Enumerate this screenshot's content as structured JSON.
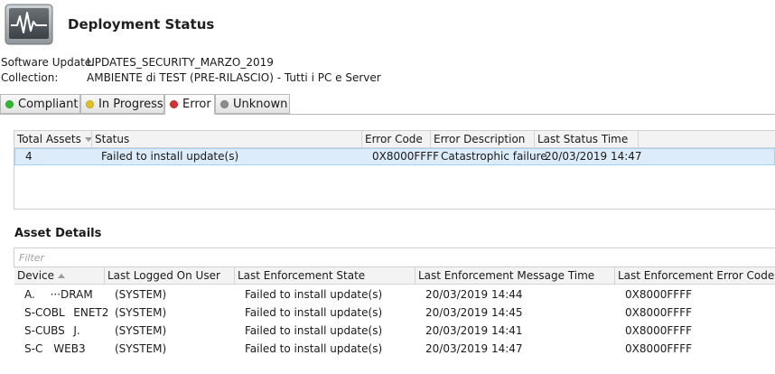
{
  "header": {
    "title": "Deployment Status",
    "icon": "monitor-chart-icon"
  },
  "info": {
    "software_update_label": "Software Update:",
    "software_update_value": "UPDATES_SECURITY_MARZO_2019",
    "collection_label": "Collection:",
    "collection_value": "AMBIENTE di TEST (PRE-RILASCIO) - Tutti i PC e Server"
  },
  "tabs": [
    {
      "label": "Compliant",
      "color": "#2db82d"
    },
    {
      "label": "In Progress",
      "color": "#e0c020"
    },
    {
      "label": "Error",
      "color": "#d83030"
    },
    {
      "label": "Unknown",
      "color": "#8c8c8c"
    }
  ],
  "active_tab": "Error",
  "summary": {
    "columns": [
      "Total Assets",
      "Status",
      "Error Code",
      "Error Description",
      "Last Status Time"
    ],
    "rows": [
      [
        "4",
        "Failed to install update(s)",
        "0X8000FFFF",
        "Catastrophic failure",
        "20/03/2019 14:47"
      ]
    ]
  },
  "asset_details": {
    "title": "Asset Details",
    "filter_placeholder": "Filter",
    "columns": [
      "Device",
      "Last Logged On User",
      "Last Enforcement State",
      "Last Enforcement Message Time",
      "Last Enforcement Error Code"
    ],
    "rows": [
      [
        "A.       ···DRAM",
        "(SYSTEM)",
        "Failed to install update(s)",
        "20/03/2019 14:44",
        "0X8000FFFF"
      ],
      [
        "S-COBL    ENET2",
        "(SYSTEM)",
        "Failed to install update(s)",
        "20/03/2019 14:45",
        "0X8000FFFF"
      ],
      [
        "S-CUBS    J.  ",
        "(SYSTEM)",
        "Failed to install update(s)",
        "20/03/2019 14:41",
        "0X8000FFFF"
      ],
      [
        "S-C     WEB3",
        "(SYSTEM)",
        "Failed to install update(s)",
        "20/03/2019 14:47",
        "0X8000FFFF"
      ]
    ]
  }
}
